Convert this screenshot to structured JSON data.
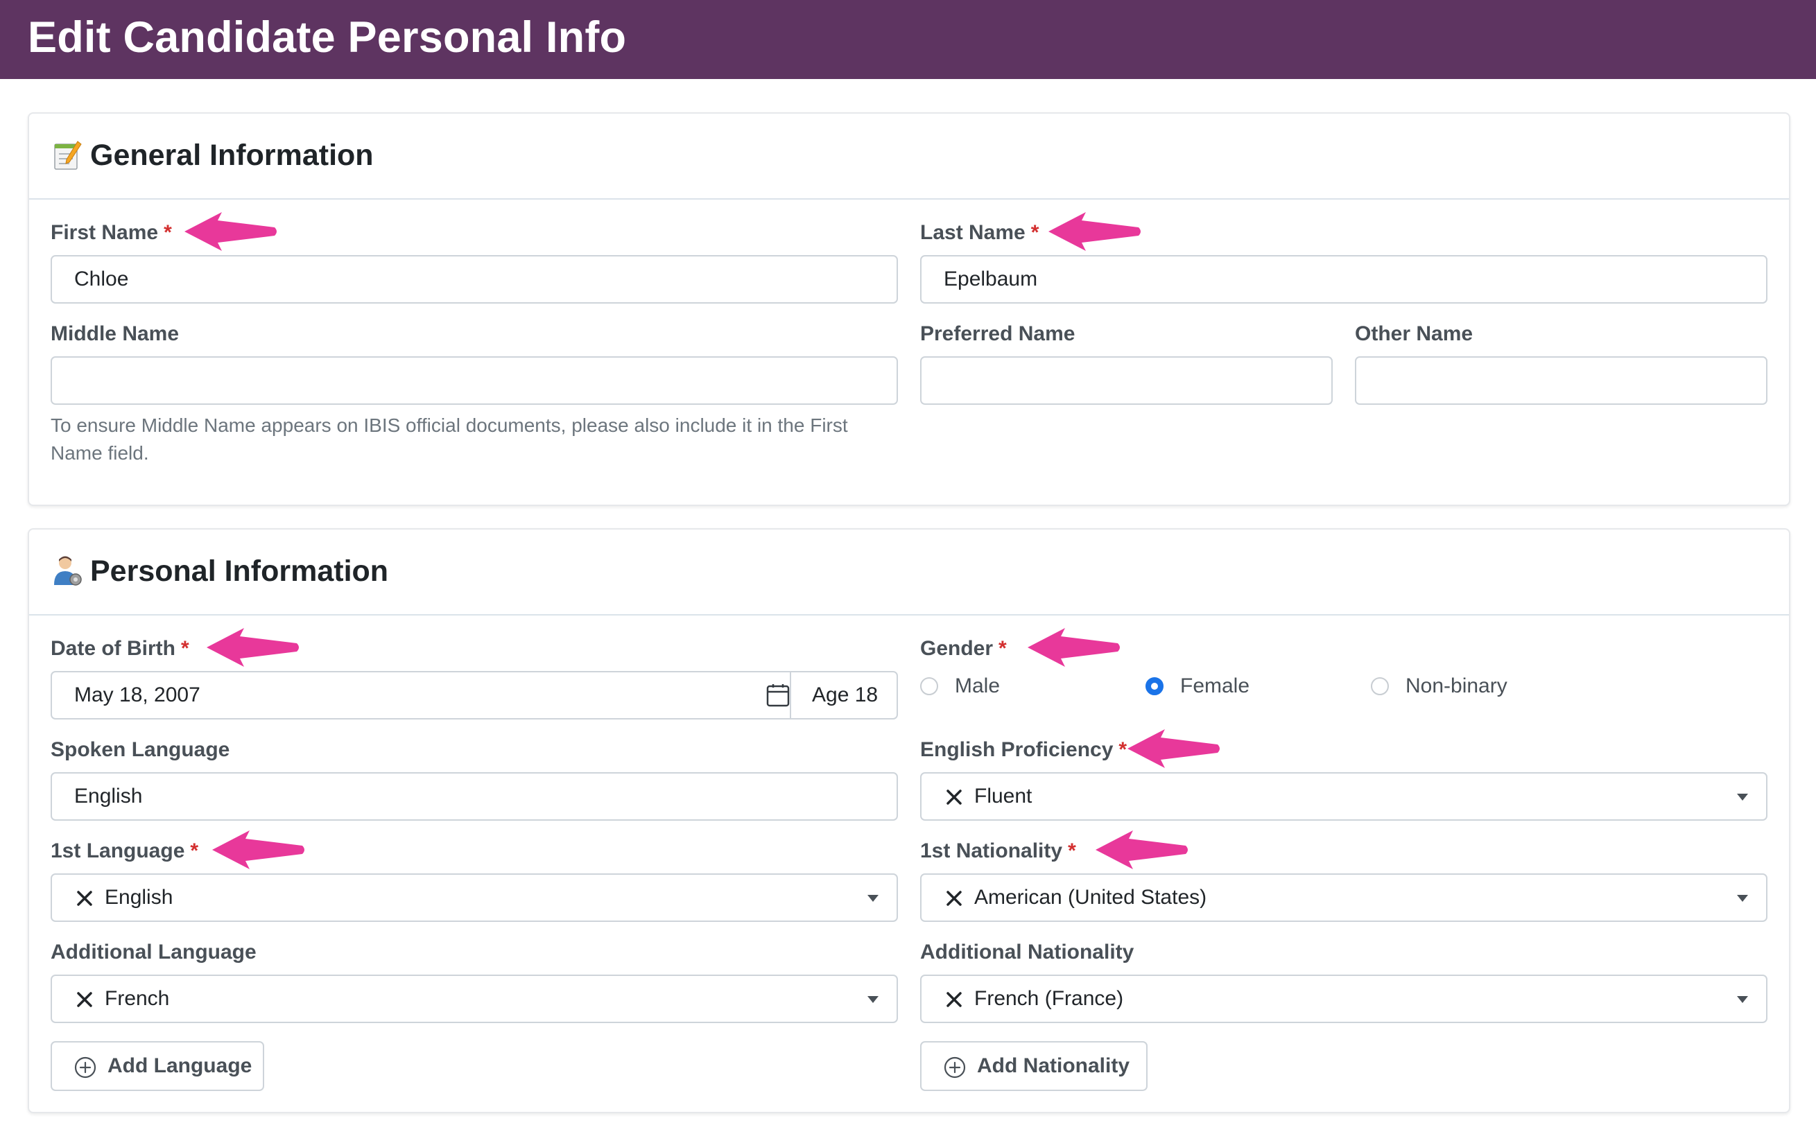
{
  "page": {
    "title": "Edit Candidate Personal Info"
  },
  "general": {
    "title": "General Information",
    "icon": "memo-icon",
    "first_name": {
      "label": "First Name",
      "required": "*",
      "value": "Chloe"
    },
    "last_name": {
      "label": "Last Name",
      "required": "*",
      "value": "Epelbaum"
    },
    "middle_name": {
      "label": "Middle Name",
      "value": "",
      "help": "To ensure Middle Name appears on IBIS official documents, please also include it in the First Name field."
    },
    "preferred_name": {
      "label": "Preferred Name",
      "value": ""
    },
    "other_name": {
      "label": "Other Name",
      "value": ""
    }
  },
  "personal": {
    "title": "Personal Information",
    "icon": "person-gear-icon",
    "dob": {
      "label": "Date of Birth",
      "required": "*",
      "value": "May 18, 2007",
      "age": "Age 18"
    },
    "gender": {
      "label": "Gender",
      "required": "*",
      "options": [
        "Male",
        "Female",
        "Non-binary"
      ],
      "selected": "Female"
    },
    "spoken_language": {
      "label": "Spoken Language",
      "value": "English"
    },
    "english_proficiency": {
      "label": "English Proficiency",
      "required": "*",
      "value": "Fluent"
    },
    "first_language": {
      "label": "1st Language",
      "required": "*",
      "value": "English"
    },
    "first_nationality": {
      "label": "1st Nationality",
      "required": "*",
      "value": "American (United States)"
    },
    "additional_language": {
      "label": "Additional Language",
      "value": "French"
    },
    "additional_nationality": {
      "label": "Additional Nationality",
      "value": "French (France)"
    },
    "add_language_button": "Add Language",
    "add_nationality_button": "Add Nationality"
  },
  "colors": {
    "header_bg": "#5e3461",
    "required": "#d32f2f",
    "annotation_arrow": "#e8389a",
    "radio_selected": "#1a73e8"
  }
}
